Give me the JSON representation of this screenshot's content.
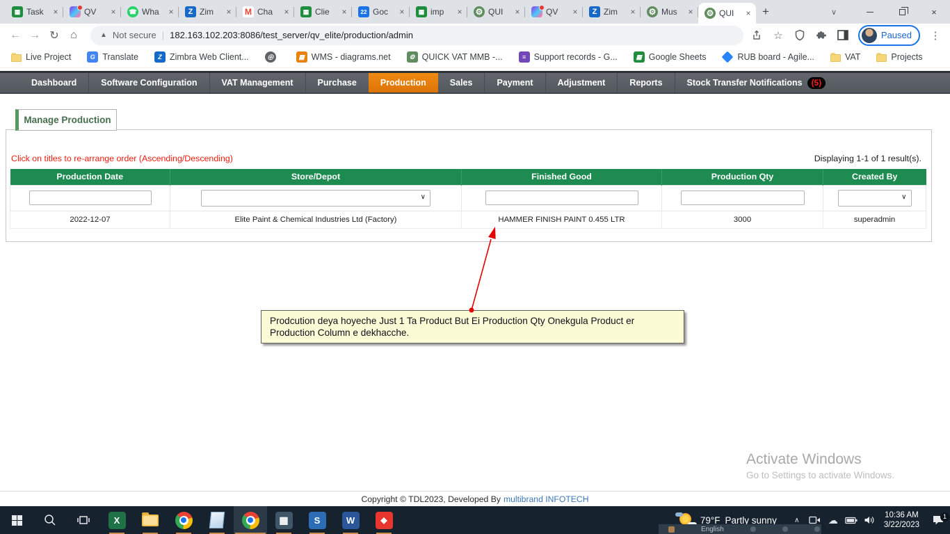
{
  "glyphs": {
    "plus": "+",
    "close": "×",
    "chevron_down": "∨",
    "chevron_up": "∧",
    "back": "←",
    "forward": "→",
    "reload": "↻",
    "home": "⌂",
    "warning": "▲",
    "star": "☆",
    "kebab": "⋮",
    "url_divider": "|"
  },
  "icon_glyphs": {
    "sheet": "▦",
    "gear": "⚙",
    "zimbra": "Z",
    "gmail": "M",
    "calendar": "22",
    "whatsapp": "☎",
    "globe": "⊕",
    "translate": "G",
    "wms": "▦",
    "support": "≡",
    "excel": "X",
    "word": "W",
    "s_app": "S",
    "diamond": "◆",
    "calc": "▦"
  },
  "browser": {
    "tabs": [
      {
        "label": "Task"
      },
      {
        "label": "QV"
      },
      {
        "label": "Wha"
      },
      {
        "label": "Zim"
      },
      {
        "label": "Cha"
      },
      {
        "label": "Clie"
      },
      {
        "label": "Goc"
      },
      {
        "label": "imp"
      },
      {
        "label": "QUI"
      },
      {
        "label": "QV"
      },
      {
        "label": "Zim"
      },
      {
        "label": "Mus"
      },
      {
        "label": "QUI"
      }
    ],
    "address_bar": {
      "security": "Not secure",
      "url": "182.163.102.203:8086/test_server/qv_elite/production/admin"
    },
    "profile": {
      "label": "Paused"
    },
    "bookmarks": [
      {
        "label": "Live Project"
      },
      {
        "label": "Translate"
      },
      {
        "label": "Zimbra Web Client..."
      },
      {
        "label": ""
      },
      {
        "label": "WMS - diagrams.net"
      },
      {
        "label": "QUICK VAT MMB -..."
      },
      {
        "label": "Support records - G..."
      },
      {
        "label": "Google Sheets"
      },
      {
        "label": "RUB board - Agile..."
      },
      {
        "label": "VAT"
      },
      {
        "label": "Projects"
      }
    ]
  },
  "nav": {
    "items": [
      "Dashboard",
      "Software Configuration",
      "VAT Management",
      "Purchase",
      "Production",
      "Sales",
      "Payment",
      "Adjustment",
      "Reports",
      "Stock Transfer Notifications"
    ],
    "active_item": "Production",
    "notification_badge": "(5)"
  },
  "page": {
    "panel_title": "Manage Production",
    "sort_hint": "Click on titles to re-arrange order (Ascending/Descending)",
    "results_summary": "Displaying 1-1 of 1 result(s).",
    "table": {
      "headers": [
        "Production Date",
        "Store/Depot",
        "Finished Good",
        "Production Qty",
        "Created By"
      ],
      "row": {
        "production_date": "2022-12-07",
        "store_depot": "Elite Paint & Chemical Industries Ltd (Factory)",
        "finished_good": "HAMMER FINISH PAINT 0.455 LTR",
        "production_qty": "3000",
        "created_by": "superadmin"
      }
    },
    "annotation_note": "Prodcution deya hoyeche Just 1 Ta Product  But Ei Production Qty Onekgula Product er Production Column e dekhacche.",
    "watermark": {
      "line1": "Activate Windows",
      "line2": "Go to Settings to activate Windows."
    },
    "footer": {
      "text": "Copyright © TDL2023, Developed By",
      "link": "multibrand INFOTECH"
    }
  },
  "taskbar": {
    "weather": {
      "temp": "79°F",
      "condition": "Partly sunny"
    },
    "clock": {
      "time": "10:36 AM",
      "date": "3/22/2023"
    },
    "notification_count": "1",
    "language_hint": "English"
  },
  "colors": {
    "header_green": "#1E8B50",
    "active_orange": "#E8790C",
    "nav_gray": "#585D63",
    "annotation_bg": "#FBFBD6",
    "badge_red": "#FF1A1A"
  }
}
